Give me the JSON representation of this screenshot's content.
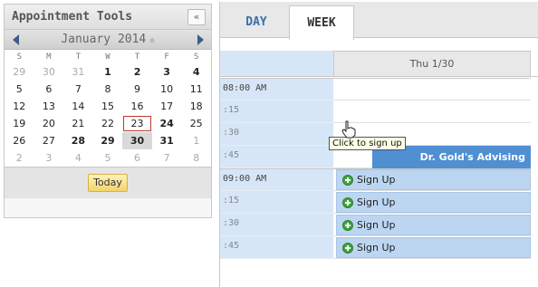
{
  "sidebar": {
    "title": "Appointment Tools",
    "collapse_label": "«",
    "calendar": {
      "month_label": "January 2014",
      "weekdays": [
        "S",
        "M",
        "T",
        "W",
        "T",
        "F",
        "S"
      ],
      "weeks": [
        [
          "29",
          "30",
          "31",
          "1",
          "2",
          "3",
          "4"
        ],
        [
          "5",
          "6",
          "7",
          "8",
          "9",
          "10",
          "11"
        ],
        [
          "12",
          "13",
          "14",
          "15",
          "16",
          "17",
          "18"
        ],
        [
          "19",
          "20",
          "21",
          "22",
          "23",
          "24",
          "25"
        ],
        [
          "26",
          "27",
          "28",
          "29",
          "30",
          "31",
          "1"
        ],
        [
          "2",
          "3",
          "4",
          "5",
          "6",
          "7",
          "8"
        ]
      ],
      "today_button": "Today"
    }
  },
  "main": {
    "tabs": [
      {
        "label": "DAY",
        "active": false
      },
      {
        "label": "WEEK",
        "active": true
      }
    ],
    "column_header": "Thu 1/30",
    "time_slots": [
      "08:00 AM",
      ":15",
      ":30",
      ":45",
      "09:00 AM",
      ":15",
      ":30",
      ":45"
    ],
    "event_title": "Dr. Gold's Advising",
    "signup_label": "Sign Up",
    "tooltip": "Click to sign up"
  },
  "colors": {
    "accent": "#4f8fd2",
    "gutter": "#d6e6f7",
    "slot": "#bcd6f1",
    "today_outline": "#c0392b"
  }
}
